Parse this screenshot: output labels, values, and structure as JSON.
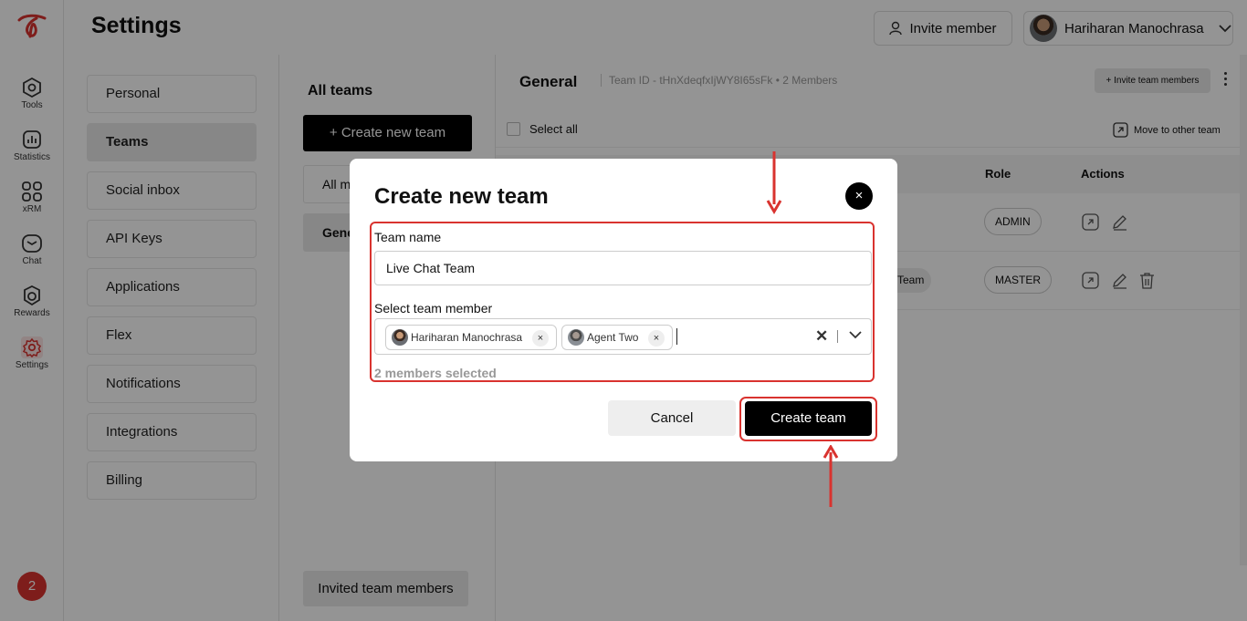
{
  "page": {
    "title": "Settings"
  },
  "header": {
    "invite_member_label": "Invite member",
    "user_name": "Hariharan Manochrasa"
  },
  "rail": {
    "items": [
      {
        "label": "Tools",
        "icon": "hexagon-gear-icon"
      },
      {
        "label": "Statistics",
        "icon": "bar-chart-icon"
      },
      {
        "label": "xRM",
        "icon": "grid-icon"
      },
      {
        "label": "Chat",
        "icon": "chat-icon"
      },
      {
        "label": "Rewards",
        "icon": "reward-icon"
      },
      {
        "label": "Settings",
        "icon": "gear-icon"
      }
    ],
    "notification_count": "2"
  },
  "settings_nav": {
    "items": [
      "Personal",
      "Teams",
      "Social inbox",
      "API Keys",
      "Applications",
      "Flex",
      "Notifications",
      "Integrations",
      "Billing"
    ],
    "active": "Teams"
  },
  "teams": {
    "title": "All teams",
    "create_label": "+ Create new team",
    "items": [
      "All m",
      "Gene"
    ],
    "invited_label": "Invited team members"
  },
  "main": {
    "title": "General",
    "team_meta": "Team ID - tHnXdeqfxIjWY8I65sFk  •  2 Members",
    "invite_team_label": "+ Invite team members",
    "select_all_label": "Select all",
    "move_label": "Move to other team",
    "columns": {
      "role": "Role",
      "actions": "Actions"
    },
    "rows": [
      {
        "team": "",
        "role": "ADMIN"
      },
      {
        "team": "Team",
        "role": "MASTER"
      }
    ]
  },
  "modal": {
    "title": "Create new team",
    "team_name_label": "Team name",
    "team_name_value": "Live Chat Team",
    "member_label": "Select team member",
    "members": [
      "Hariharan Manochrasa",
      "Agent Two"
    ],
    "tag_remove": "×",
    "clear_symbol": "✕",
    "selected_count": "2 members selected",
    "cancel_label": "Cancel",
    "create_label": "Create team",
    "close_symbol": "×"
  },
  "colors": {
    "accent": "#d9332f",
    "primary": "#000000",
    "muted": "#999999"
  }
}
